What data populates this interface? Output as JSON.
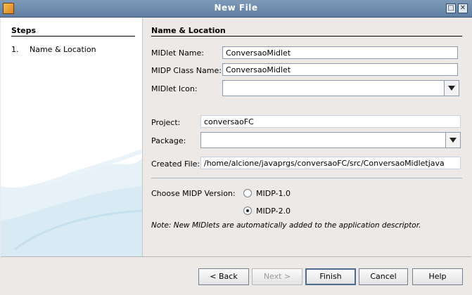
{
  "window": {
    "title": "New File",
    "app_icon": "netbeans-icon",
    "maximize_icon": "maximize-icon",
    "close_icon": "close-icon"
  },
  "steps": {
    "title": "Steps",
    "items": [
      {
        "number": "1.",
        "label": "Name & Location"
      }
    ]
  },
  "section": {
    "title": "Name & Location"
  },
  "form": {
    "midlet_name": {
      "label": "MIDlet Name:",
      "value": "ConversaoMidlet"
    },
    "midp_class_name": {
      "label": "MIDP Class Name:",
      "value": "ConversaoMidlet"
    },
    "midlet_icon": {
      "label": "MIDlet Icon:",
      "value": ""
    },
    "project": {
      "label": "Project:",
      "value": "conversaoFC"
    },
    "package": {
      "label": "Package:",
      "value": ""
    },
    "created_file": {
      "label": "Created File:",
      "value": "/home/alcione/javaprgs/conversaoFC/src/ConversaoMidletjava"
    },
    "midp_version": {
      "label": "Choose MIDP Version:",
      "options": [
        {
          "label": "MIDP-1.0",
          "selected": false
        },
        {
          "label": "MIDP-2.0",
          "selected": true
        }
      ]
    },
    "note": "Note: New MIDlets are automatically added to the application descriptor."
  },
  "buttons": {
    "back": "< Back",
    "next": "Next >",
    "finish": "Finish",
    "cancel": "Cancel",
    "help": "Help"
  },
  "colors": {
    "titlebar": "#6f8cae",
    "left_panel": "#ffffff",
    "panel_decor": "#dcecf5",
    "dialog_bg": "#ece9e6"
  }
}
